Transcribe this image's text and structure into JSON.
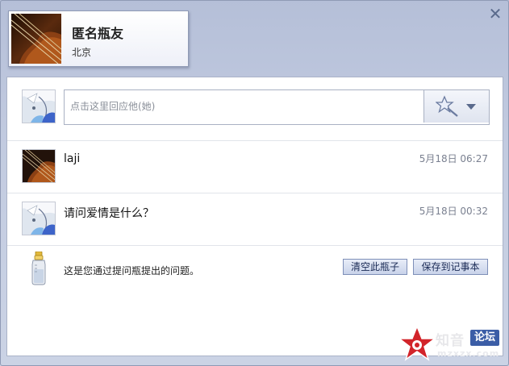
{
  "window": {
    "close_icon": "close-icon"
  },
  "header": {
    "name": "匿名瓶友",
    "city": "北京",
    "avatar_icon": "violin-avatar-icon"
  },
  "reply": {
    "placeholder": "点击这里回应他(她)",
    "avatar_icon": "anime-avatar-icon",
    "emoji_icon": "magic-wand-icon"
  },
  "messages": [
    {
      "text": "laji",
      "time": "5月18日 06:27",
      "avatar_icon": "violin-avatar-icon"
    },
    {
      "text": "请问爱情是什么？",
      "time": "5月18日 00:32",
      "avatar_icon": "anime-avatar-icon"
    }
  ],
  "footer": {
    "text": "这是您通过提问瓶提出的问题。",
    "icon": "bottle-icon",
    "clear_label": "清空此瓶子",
    "save_label": "保存到记事本"
  },
  "watermark": {
    "text": "知音",
    "badge": "论坛",
    "url": "mzxzx.com"
  },
  "colors": {
    "background": "#c2cbe0",
    "panel": "#ffffff",
    "border": "#8f9ab5",
    "button_bg": "#c9d3ea",
    "button_text": "#1a2a55",
    "time_text": "#7a8090"
  }
}
